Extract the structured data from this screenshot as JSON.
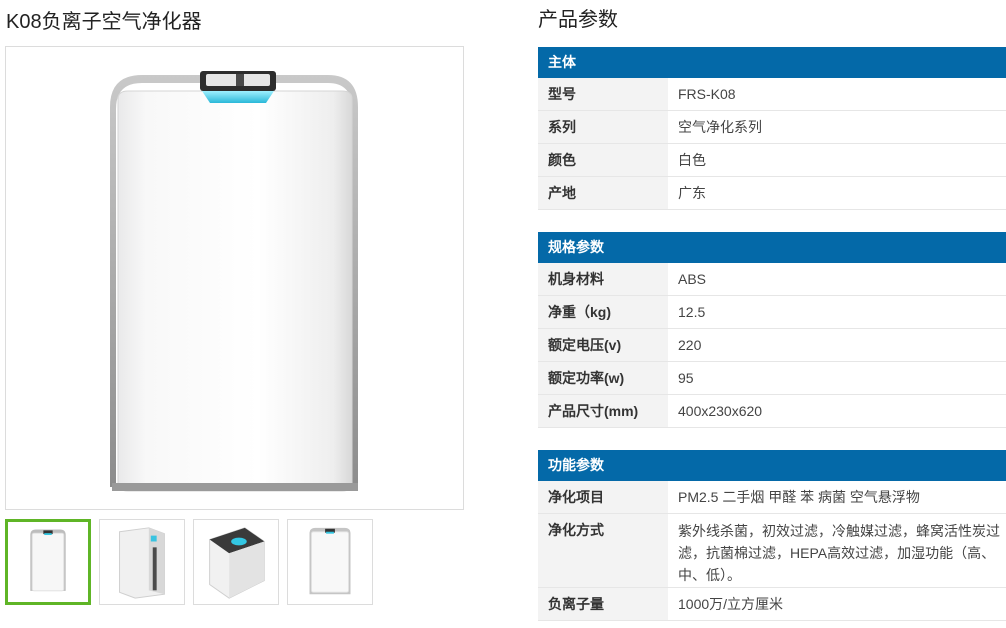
{
  "product": {
    "title": "K08负离子空气净化器"
  },
  "thumbnails": [
    {
      "name": "front-view",
      "active": true
    },
    {
      "name": "side-view",
      "active": false
    },
    {
      "name": "top-view",
      "active": false
    },
    {
      "name": "front-view-2",
      "active": false
    }
  ],
  "params_title": "产品参数",
  "sections": {
    "main": {
      "header": "主体",
      "rows": [
        {
          "k": "型号",
          "v": "FRS-K08"
        },
        {
          "k": "系列",
          "v": "空气净化系列"
        },
        {
          "k": "颜色",
          "v": "白色"
        },
        {
          "k": "产地",
          "v": "广东"
        }
      ]
    },
    "specs": {
      "header": "规格参数",
      "rows": [
        {
          "k": "机身材料",
          "v": "ABS"
        },
        {
          "k": "净重（kg)",
          "v": "12.5"
        },
        {
          "k": "额定电压(v)",
          "v": "220"
        },
        {
          "k": "额定功率(w)",
          "v": "95"
        },
        {
          "k": "产品尺寸(mm)",
          "v": "400x230x620"
        }
      ]
    },
    "features": {
      "header": "功能参数",
      "rows": [
        {
          "k": "净化项目",
          "v": "PM2.5 二手烟 甲醛 苯 病菌 空气悬浮物"
        },
        {
          "k": "净化方式",
          "v": "紫外线杀菌，初效过滤，冷触媒过滤，蜂窝活性炭过滤，抗菌棉过滤，HEPA高效过滤，加湿功能（高、中、低）。"
        },
        {
          "k": "负离子量",
          "v": "1000万/立方厘米"
        }
      ]
    }
  },
  "colors": {
    "header_bg": "#0469a8",
    "active_thumb_border": "#5fb526",
    "light_cell": "#f3f3f3"
  }
}
